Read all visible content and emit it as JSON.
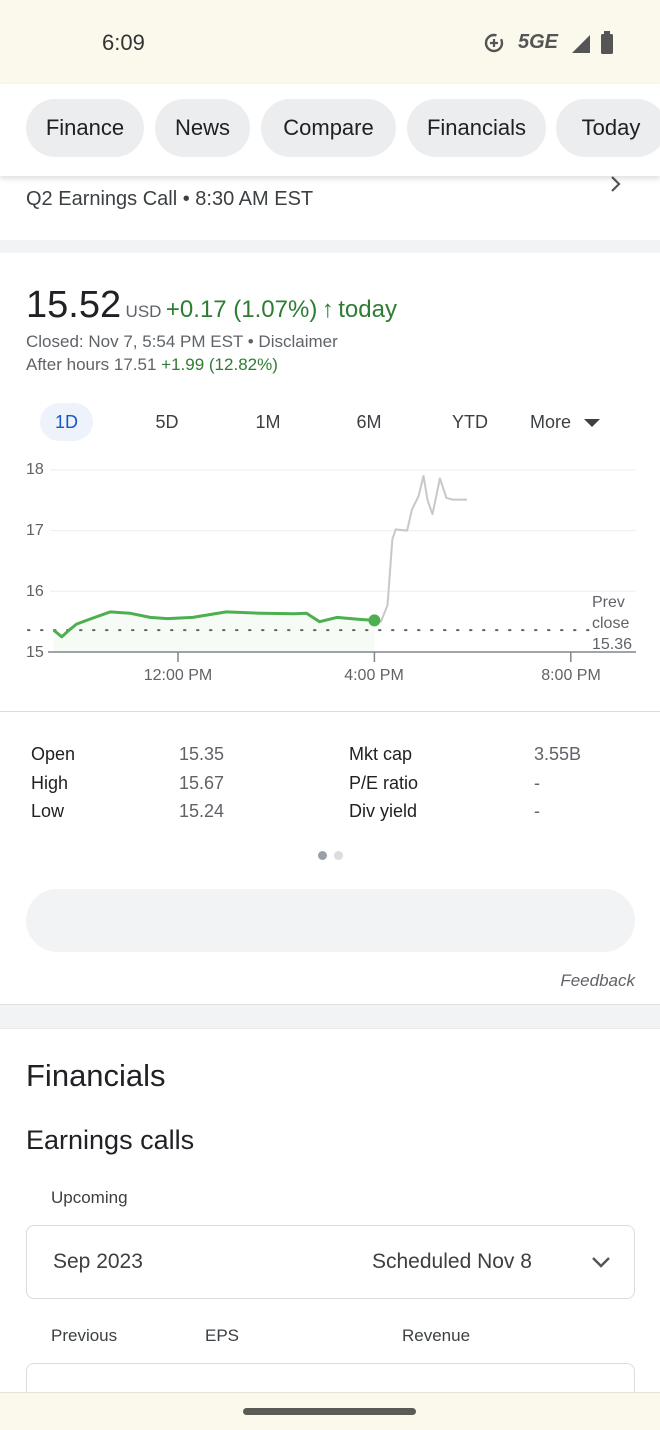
{
  "status_bar": {
    "time": "6:09",
    "network": "5GE",
    "icons": [
      "data-saver-icon",
      "signal-icon",
      "battery-icon"
    ]
  },
  "chips": [
    "Finance",
    "News",
    "Compare",
    "Financials",
    "Today"
  ],
  "event": {
    "text": "Q2 Earnings Call • 8:30 AM EST",
    "icon": "chevron-right-icon"
  },
  "quote": {
    "price": "15.52",
    "currency": "USD",
    "change": "+0.17 (1.07%)",
    "arrow": "↑",
    "period": "today",
    "closed": "Closed: Nov 7, 5:54 PM EST",
    "disclaimer": "Disclaimer",
    "after_label": "After hours 17.51",
    "after_change": "+1.99 (12.82%)"
  },
  "ranges": {
    "items": [
      "1D",
      "5D",
      "1M",
      "6M",
      "YTD"
    ],
    "selected": "1D",
    "more": "More"
  },
  "colors": {
    "up": "#2e7d32",
    "line": "#4caf50",
    "after_hours_line": "#c8c8c8",
    "selected_range": "#1a56c4"
  },
  "chart_data": {
    "type": "line",
    "y_ticks": [
      "18",
      "17",
      "16",
      "15"
    ],
    "ylim": [
      15,
      18
    ],
    "x_ticks": [
      "12:00 PM",
      "4:00 PM",
      "8:00 PM"
    ],
    "xlim": [
      "09:30",
      "21:15"
    ],
    "grid": true,
    "prev_close": {
      "label_1": "Prev",
      "label_2": "close",
      "value": "15.36"
    },
    "series": [
      {
        "session": "regular",
        "points": [
          [
            "09:28",
            15.36
          ],
          [
            "09:38",
            15.25
          ],
          [
            "09:46",
            15.35
          ],
          [
            "09:56",
            15.46
          ],
          [
            "10:14",
            15.55
          ],
          [
            "10:37",
            15.66
          ],
          [
            "11:01",
            15.64
          ],
          [
            "11:26",
            15.57
          ],
          [
            "11:47",
            15.55
          ],
          [
            "12:18",
            15.57
          ],
          [
            "12:59",
            15.66
          ],
          [
            "13:41",
            15.64
          ],
          [
            "14:22",
            15.63
          ],
          [
            "14:37",
            15.64
          ],
          [
            "14:53",
            15.5
          ],
          [
            "15:14",
            15.57
          ],
          [
            "15:40",
            15.54
          ],
          [
            "16:00",
            15.52
          ]
        ]
      },
      {
        "session": "after-hours",
        "points": [
          [
            "16:00",
            15.52
          ],
          [
            "16:08",
            15.5
          ],
          [
            "16:16",
            15.77
          ],
          [
            "16:22",
            16.86
          ],
          [
            "16:26",
            17.02
          ],
          [
            "16:40",
            17.0
          ],
          [
            "16:46",
            17.35
          ],
          [
            "16:54",
            17.57
          ],
          [
            "17:00",
            17.9
          ],
          [
            "17:05",
            17.5
          ],
          [
            "17:11",
            17.27
          ],
          [
            "17:20",
            17.86
          ],
          [
            "17:28",
            17.54
          ],
          [
            "17:35",
            17.51
          ],
          [
            "17:53",
            17.51
          ]
        ]
      }
    ]
  },
  "stats": {
    "rows": [
      [
        "Open",
        "15.35",
        "Mkt cap",
        "3.55B"
      ],
      [
        "High",
        "15.67",
        "P/E ratio",
        "-"
      ],
      [
        "Low",
        "15.24",
        "Div yield",
        "-"
      ]
    ]
  },
  "feedback": "Feedback",
  "financials": {
    "title": "Financials",
    "subtitle": "Earnings calls",
    "upcoming": "Upcoming",
    "period": "Sep 2023",
    "scheduled": "Scheduled Nov 8",
    "cols": [
      "Previous",
      "EPS",
      "Revenue"
    ]
  }
}
